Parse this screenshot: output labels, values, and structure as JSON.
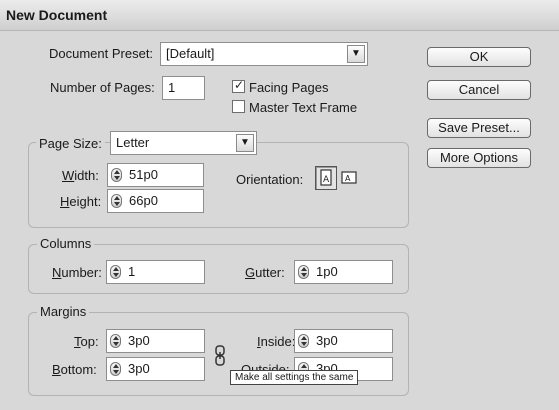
{
  "title": "New Document",
  "preset": {
    "label": "Document Preset:",
    "value": "[Default]"
  },
  "pages": {
    "label": "Number of Pages:",
    "value": "1"
  },
  "facing_pages": {
    "label": "Facing Pages",
    "checked": true
  },
  "master_text_frame": {
    "label": "Master Text Frame",
    "checked": false
  },
  "page_size": {
    "label": "Page Size:",
    "value": "Letter",
    "width_label": "Width:",
    "width": "51p0",
    "height_label": "Height:",
    "height": "66p0",
    "orientation_label": "Orientation:",
    "orientation": "portrait"
  },
  "columns": {
    "title": "Columns",
    "number_label": "Number:",
    "number": "1",
    "gutter_label": "Gutter:",
    "gutter": "1p0"
  },
  "margins": {
    "title": "Margins",
    "top_label": "Top:",
    "top": "3p0",
    "bottom_label": "Bottom:",
    "bottom": "3p0",
    "inside_label": "Inside:",
    "inside": "3p0",
    "outside_label": "Outside:",
    "outside": "3p0"
  },
  "tooltip": "Make all settings the same",
  "buttons": {
    "ok": "OK",
    "cancel": "Cancel",
    "save_preset": "Save Preset...",
    "more_options": "More Options"
  },
  "icons": {
    "dropdown": "chevron-down-icon",
    "spin": "spinner-icon",
    "portrait": "portrait-orientation-icon",
    "landscape": "landscape-orientation-icon",
    "link": "chain-link-icon"
  }
}
